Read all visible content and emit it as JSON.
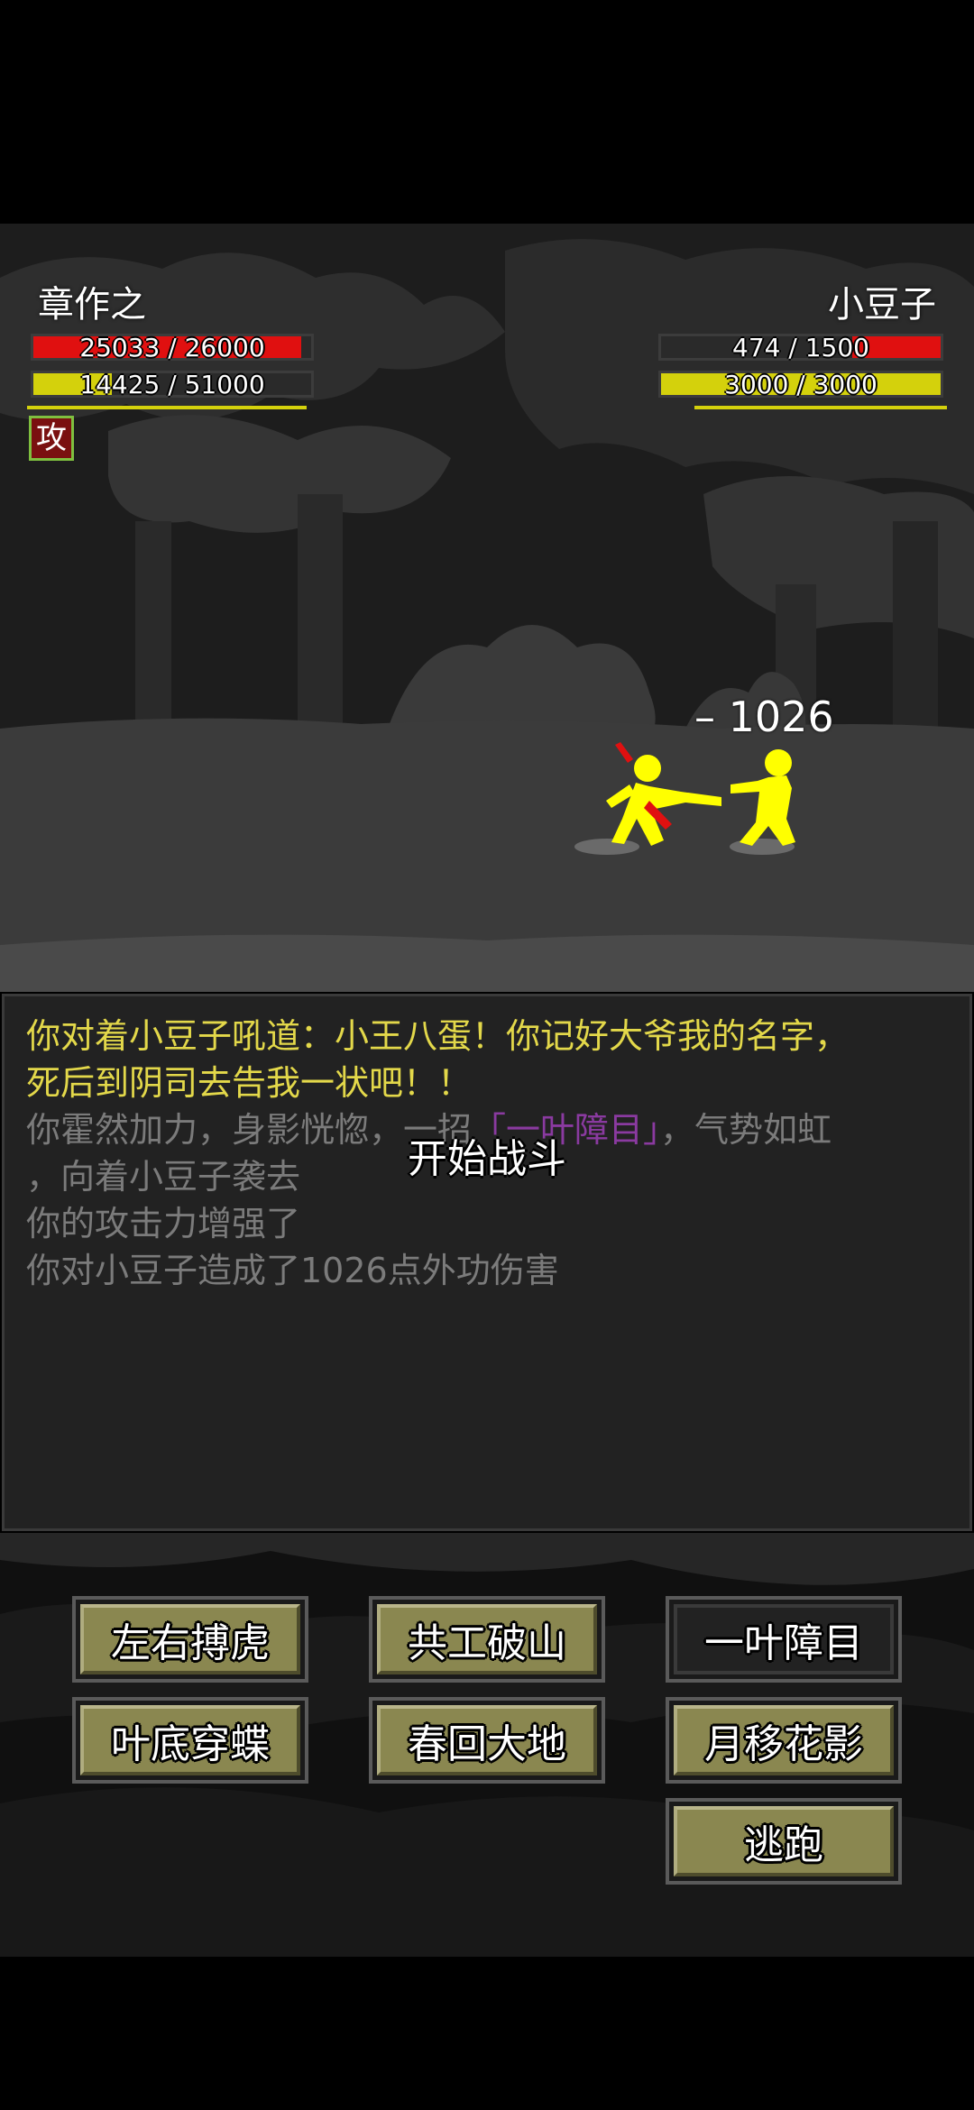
{
  "player": {
    "name": "章作之",
    "hp": {
      "current": 25033,
      "max": 26000,
      "text": "25033 / 26000",
      "color": "#e01010"
    },
    "mp": {
      "current": 14425,
      "max": 51000,
      "text": "14425 / 51000",
      "color": "#d4d10c"
    },
    "status_badge": "攻"
  },
  "enemy": {
    "name": "小豆子",
    "hp": {
      "current": 474,
      "max": 1500,
      "text": "474 / 1500",
      "color": "#e01010"
    },
    "mp": {
      "current": 3000,
      "max": 3000,
      "text": "3000 / 3000",
      "color": "#d4d10c"
    }
  },
  "damage_popup": "– 1026",
  "log": [
    {
      "text": "你对着小豆子吼道：小王八蛋！你记好大爷我的名字，",
      "color": "#e3d84a"
    },
    {
      "text": "死后到阴司去告我一状吧！！",
      "color": "#e3d84a"
    },
    {
      "parts": [
        {
          "text": "你霍然加力，身影恍惚，一招",
          "color": "#7b7b7b"
        },
        {
          "text": "「一叶障目」",
          "color": "#8a3aa0"
        },
        {
          "text": "，气势如虹",
          "color": "#7b7b7b"
        }
      ]
    },
    {
      "text": "，向着小豆子袭去",
      "color": "#7b7b7b"
    },
    {
      "text": "你的攻击力增强了",
      "color": "#7b7b7b"
    },
    {
      "text": "你对小豆子造成了1026点外功伤害",
      "color": "#7b7b7b"
    }
  ],
  "center_message": "开始战斗",
  "skills": [
    {
      "label": "左右搏虎",
      "enabled": true
    },
    {
      "label": "共工破山",
      "enabled": true
    },
    {
      "label": "一叶障目",
      "enabled": false
    },
    {
      "label": "叶底穿蝶",
      "enabled": true
    },
    {
      "label": "春回大地",
      "enabled": true
    },
    {
      "label": "月移花影",
      "enabled": true
    },
    {
      "label": "逃跑",
      "enabled": true
    }
  ]
}
